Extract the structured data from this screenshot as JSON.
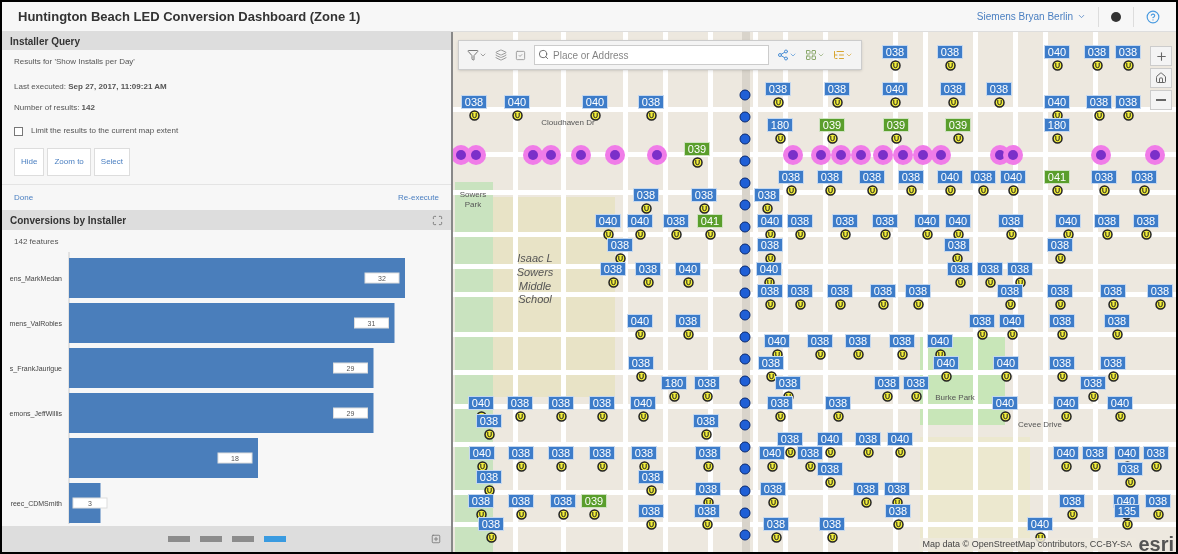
{
  "header": {
    "title": "Huntington Beach LED Conversion Dashboard (Zone 1)",
    "user": "Siemens Bryan Berlin"
  },
  "installer_query": {
    "title": "Installer Query",
    "results_for": "Results for 'Show Installs per Day'",
    "last_executed": "Last executed: **Sep 27, 2017, 11:09:21 AM**",
    "number_of_results": "Number of results: **142**",
    "limit_checkbox": {
      "label": "Limit the results to the current map extent",
      "checked": false
    },
    "buttons": [
      "Hide",
      "Zoom to",
      "Select"
    ],
    "done": "Done",
    "re_execute": "Re-execute"
  },
  "conversions_panel": {
    "title": "Conversions by Installer",
    "count": "142 features",
    "chart_data": {
      "type": "bar",
      "orientation": "horizontal",
      "categories": [
        "ens_MarkMedan",
        "mens_ValRobles",
        "s_FrankJaurigue",
        "emons_JeffWillis",
        null,
        "reec_CDMSmith"
      ],
      "series": [
        {
          "color": "#4a7ebb",
          "values": [
            32,
            31,
            29,
            29,
            18,
            3
          ]
        }
      ],
      "data_labels": true
    },
    "pages": [
      {
        "selected": false
      },
      {
        "selected": false
      },
      {
        "selected": false
      },
      {
        "selected": true
      }
    ]
  },
  "map": {
    "search": {
      "placeholder": "Place or Address"
    },
    "place_labels": [
      "Cloudhaven Dr",
      "Sowers Park",
      "Isaac L Sowers Middle School",
      "Burke Park",
      "Cevee Drive"
    ],
    "markers": [
      {
        "label": "038",
        "color": "#3d7cc9"
      },
      {
        "label": "038",
        "color": "#3d7cc9"
      },
      {
        "label": "040",
        "color": "#3d7cc9"
      },
      {
        "label": "038",
        "color": "#3d7cc9"
      },
      {
        "label": "038",
        "color": "#3d7cc9"
      },
      {
        "label": "038",
        "color": "#3d7cc9"
      },
      {
        "label": "038",
        "color": "#3d7cc9"
      },
      {
        "label": "040",
        "color": "#3d7cc9"
      },
      {
        "label": "038",
        "color": "#3d7cc9"
      },
      {
        "label": "038",
        "color": "#3d7cc9"
      },
      {
        "label": "038",
        "color": "#3d7cc9"
      },
      {
        "label": "040",
        "color": "#3d7cc9"
      },
      {
        "label": "040",
        "color": "#3d7cc9"
      },
      {
        "label": "038",
        "color": "#3d7cc9"
      },
      {
        "label": "040",
        "color": "#3d7cc9"
      },
      {
        "label": "038",
        "color": "#3d7cc9"
      },
      {
        "label": "038",
        "color": "#3d7cc9"
      },
      {
        "label": "180",
        "color": "#3d7cc9"
      },
      {
        "label": "039",
        "color": "#5a9e2c"
      },
      {
        "label": "039",
        "color": "#5a9e2c"
      },
      {
        "label": "039",
        "color": "#5a9e2c"
      },
      {
        "label": "180",
        "color": "#3d7cc9"
      },
      {
        "label": "039",
        "color": "#5a9e2c"
      },
      {
        "label": "038",
        "color": "#3d7cc9"
      },
      {
        "label": "038",
        "color": "#3d7cc9"
      },
      {
        "label": "038",
        "color": "#3d7cc9"
      },
      {
        "label": "038",
        "color": "#3d7cc9"
      },
      {
        "label": "040",
        "color": "#3d7cc9"
      },
      {
        "label": "038",
        "color": "#3d7cc9"
      },
      {
        "label": "040",
        "color": "#3d7cc9"
      },
      {
        "label": "041",
        "color": "#5a9e2c"
      },
      {
        "label": "038",
        "color": "#3d7cc9"
      },
      {
        "label": "038",
        "color": "#3d7cc9"
      },
      {
        "label": "038",
        "color": "#3d7cc9"
      },
      {
        "label": "038",
        "color": "#3d7cc9"
      },
      {
        "label": "038",
        "color": "#3d7cc9"
      },
      {
        "label": "040",
        "color": "#3d7cc9"
      },
      {
        "label": "040",
        "color": "#3d7cc9"
      },
      {
        "label": "038",
        "color": "#3d7cc9"
      },
      {
        "label": "041",
        "color": "#5a9e2c"
      },
      {
        "label": "040",
        "color": "#3d7cc9"
      },
      {
        "label": "038",
        "color": "#3d7cc9"
      },
      {
        "label": "038",
        "color": "#3d7cc9"
      },
      {
        "label": "038",
        "color": "#3d7cc9"
      },
      {
        "label": "040",
        "color": "#3d7cc9"
      },
      {
        "label": "040",
        "color": "#3d7cc9"
      },
      {
        "label": "038",
        "color": "#3d7cc9"
      },
      {
        "label": "040",
        "color": "#3d7cc9"
      },
      {
        "label": "038",
        "color": "#3d7cc9"
      },
      {
        "label": "038",
        "color": "#3d7cc9"
      },
      {
        "label": "038",
        "color": "#3d7cc9"
      },
      {
        "label": "038",
        "color": "#3d7cc9"
      },
      {
        "label": "038",
        "color": "#3d7cc9"
      },
      {
        "label": "038",
        "color": "#3d7cc9"
      },
      {
        "label": "038",
        "color": "#3d7cc9"
      },
      {
        "label": "038",
        "color": "#3d7cc9"
      },
      {
        "label": "040",
        "color": "#3d7cc9"
      },
      {
        "label": "040",
        "color": "#3d7cc9"
      },
      {
        "label": "038",
        "color": "#3d7cc9"
      },
      {
        "label": "038",
        "color": "#3d7cc9"
      },
      {
        "label": "038",
        "color": "#3d7cc9"
      },
      {
        "label": "038",
        "color": "#3d7cc9"
      },
      {
        "label": "038",
        "color": "#3d7cc9"
      },
      {
        "label": "038",
        "color": "#3d7cc9"
      },
      {
        "label": "038",
        "color": "#3d7cc9"
      },
      {
        "label": "038",
        "color": "#3d7cc9"
      },
      {
        "label": "038",
        "color": "#3d7cc9"
      },
      {
        "label": "038",
        "color": "#3d7cc9"
      },
      {
        "label": "038",
        "color": "#3d7cc9"
      },
      {
        "label": "038",
        "color": "#3d7cc9"
      },
      {
        "label": "040",
        "color": "#3d7cc9"
      },
      {
        "label": "038",
        "color": "#3d7cc9"
      },
      {
        "label": "038",
        "color": "#3d7cc9"
      },
      {
        "label": "040",
        "color": "#3d7cc9"
      },
      {
        "label": "038",
        "color": "#3d7cc9"
      },
      {
        "label": "038",
        "color": "#3d7cc9"
      },
      {
        "label": "040",
        "color": "#3d7cc9"
      },
      {
        "label": "038",
        "color": "#3d7cc9"
      },
      {
        "label": "038",
        "color": "#3d7cc9"
      },
      {
        "label": "038",
        "color": "#3d7cc9"
      },
      {
        "label": "040",
        "color": "#3d7cc9"
      },
      {
        "label": "038",
        "color": "#3d7cc9"
      },
      {
        "label": "038",
        "color": "#3d7cc9"
      },
      {
        "label": "040",
        "color": "#3d7cc9"
      },
      {
        "label": "040",
        "color": "#3d7cc9"
      },
      {
        "label": "038",
        "color": "#3d7cc9"
      },
      {
        "label": "038",
        "color": "#3d7cc9"
      },
      {
        "label": "180",
        "color": "#3d7cc9"
      },
      {
        "label": "038",
        "color": "#3d7cc9"
      },
      {
        "label": "038",
        "color": "#3d7cc9"
      },
      {
        "label": "038",
        "color": "#3d7cc9"
      },
      {
        "label": "038",
        "color": "#3d7cc9"
      },
      {
        "label": "038",
        "color": "#3d7cc9"
      },
      {
        "label": "040",
        "color": "#3d7cc9"
      },
      {
        "label": "038",
        "color": "#3d7cc9"
      },
      {
        "label": "038",
        "color": "#3d7cc9"
      },
      {
        "label": "038",
        "color": "#3d7cc9"
      },
      {
        "label": "040",
        "color": "#3d7cc9"
      },
      {
        "label": "038",
        "color": "#3d7cc9"
      },
      {
        "label": "038",
        "color": "#3d7cc9"
      },
      {
        "label": "040",
        "color": "#3d7cc9"
      },
      {
        "label": "040",
        "color": "#3d7cc9"
      },
      {
        "label": "040",
        "color": "#3d7cc9"
      },
      {
        "label": "038",
        "color": "#3d7cc9"
      },
      {
        "label": "038",
        "color": "#3d7cc9"
      },
      {
        "label": "038",
        "color": "#3d7cc9"
      },
      {
        "label": "040",
        "color": "#3d7cc9"
      },
      {
        "label": "038",
        "color": "#3d7cc9"
      },
      {
        "label": "040",
        "color": "#3d7cc9"
      },
      {
        "label": "040",
        "color": "#3d7cc9"
      },
      {
        "label": "038",
        "color": "#3d7cc9"
      },
      {
        "label": "038",
        "color": "#3d7cc9"
      },
      {
        "label": "038",
        "color": "#3d7cc9"
      },
      {
        "label": "038",
        "color": "#3d7cc9"
      },
      {
        "label": "038",
        "color": "#3d7cc9"
      },
      {
        "label": "040",
        "color": "#3d7cc9"
      },
      {
        "label": "038",
        "color": "#3d7cc9"
      },
      {
        "label": "040",
        "color": "#3d7cc9"
      },
      {
        "label": "038",
        "color": "#3d7cc9"
      },
      {
        "label": "040",
        "color": "#3d7cc9"
      },
      {
        "label": "038",
        "color": "#3d7cc9"
      },
      {
        "label": "038",
        "color": "#3d7cc9"
      },
      {
        "label": "038",
        "color": "#3d7cc9"
      },
      {
        "label": "038",
        "color": "#3d7cc9"
      },
      {
        "label": "038",
        "color": "#3d7cc9"
      },
      {
        "label": "038",
        "color": "#3d7cc9"
      },
      {
        "label": "038",
        "color": "#3d7cc9"
      },
      {
        "label": "038",
        "color": "#3d7cc9"
      },
      {
        "label": "038",
        "color": "#3d7cc9"
      },
      {
        "label": "038",
        "color": "#3d7cc9"
      },
      {
        "label": "038",
        "color": "#3d7cc9"
      },
      {
        "label": "038",
        "color": "#3d7cc9"
      },
      {
        "label": "039",
        "color": "#5a9e2c"
      },
      {
        "label": "038",
        "color": "#3d7cc9"
      },
      {
        "label": "040",
        "color": "#3d7cc9"
      },
      {
        "label": "038",
        "color": "#3d7cc9"
      },
      {
        "label": "038",
        "color": "#3d7cc9"
      },
      {
        "label": "038",
        "color": "#3d7cc9"
      },
      {
        "label": "038",
        "color": "#3d7cc9"
      },
      {
        "label": "135",
        "color": "#3d7cc9"
      },
      {
        "label": "038",
        "color": "#3d7cc9"
      },
      {
        "label": "038",
        "color": "#3d7cc9"
      },
      {
        "label": "038",
        "color": "#3d7cc9"
      },
      {
        "label": "040",
        "color": "#3d7cc9"
      }
    ],
    "attribution": "Map data © OpenStreetMap contributors, CC-BY-SA",
    "logo": "esri"
  }
}
